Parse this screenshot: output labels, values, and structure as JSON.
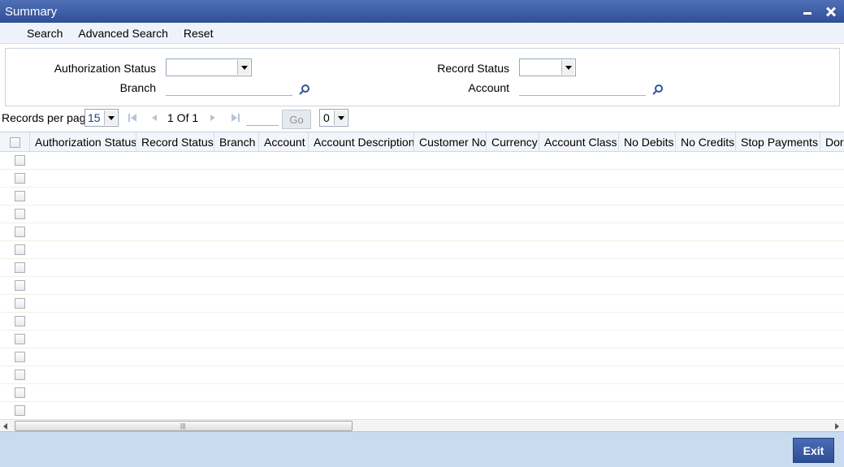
{
  "window": {
    "title": "Summary"
  },
  "menu": {
    "search": "Search",
    "advanced_search": "Advanced Search",
    "reset": "Reset"
  },
  "filters": {
    "authorization_status_label": "Authorization Status",
    "record_status_label": "Record Status",
    "branch_label": "Branch",
    "account_label": "Account",
    "authorization_status_value": "",
    "record_status_value": "",
    "branch_value": "",
    "account_value": ""
  },
  "pager": {
    "records_per_page_label": "Records per page",
    "records_per_page_value": "15",
    "page_info": "1 Of 1",
    "go_label": "Go",
    "jump_value": "0"
  },
  "grid": {
    "columns": [
      "Authorization Status",
      "Record Status",
      "Branch",
      "Account",
      "Account Description",
      "Customer No",
      "Currency",
      "Account Class",
      "No Debits",
      "No Credits",
      "Stop Payments",
      "Dormant"
    ],
    "row_count": 15
  },
  "footer": {
    "exit_label": "Exit"
  },
  "colors": {
    "title_bar": "#3a5ba6",
    "footer": "#c9dcef",
    "exit_button": "#3a5ba6"
  }
}
